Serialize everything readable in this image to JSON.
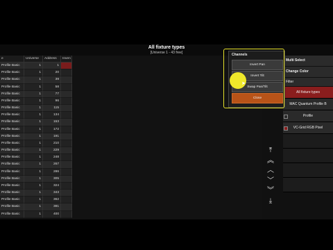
{
  "window": {
    "title": "All fixture types",
    "subtitle": "[Universe 1 - 43 free]"
  },
  "table": {
    "headers": [
      "e",
      "Universe",
      "Address",
      "Inven"
    ],
    "rows": [
      [
        "Profile Basic",
        "1",
        "1"
      ],
      [
        "Profile Basic",
        "1",
        "20"
      ],
      [
        "Profile Basic",
        "1",
        "39"
      ],
      [
        "Profile Basic",
        "1",
        "58"
      ],
      [
        "Profile Basic",
        "1",
        "77"
      ],
      [
        "Profile Basic",
        "1",
        "96"
      ],
      [
        "Profile Basic",
        "1",
        "115"
      ],
      [
        "Profile Basic",
        "1",
        "134"
      ],
      [
        "Profile Basic",
        "1",
        "153"
      ],
      [
        "Profile Basic",
        "1",
        "172"
      ],
      [
        "Profile Basic",
        "1",
        "191"
      ],
      [
        "Profile Basic",
        "1",
        "210"
      ],
      [
        "Profile Basic",
        "1",
        "229"
      ],
      [
        "Profile Basic",
        "1",
        "248"
      ],
      [
        "Profile Basic",
        "1",
        "267"
      ],
      [
        "Profile Basic",
        "1",
        "286"
      ],
      [
        "Profile Basic",
        "1",
        "305"
      ],
      [
        "Profile Basic",
        "1",
        "324"
      ],
      [
        "Profile Basic",
        "1",
        "343"
      ],
      [
        "Profile Basic",
        "1",
        "362"
      ],
      [
        "Profile Basic",
        "1",
        "381"
      ],
      [
        "Profile Basic",
        "1",
        "400"
      ]
    ]
  },
  "right_panel": {
    "multi_select": "Multi Select",
    "change_color": "Change Color",
    "filter": "Filter",
    "items": [
      "All fixture types",
      "MAC Quantum Profile B",
      "Profile",
      "VC-Grid RGB Pixel"
    ]
  },
  "popup": {
    "title": "Channels",
    "buttons": [
      "Invert Pan",
      "Invert Tilt",
      "Swap Pan/Tilt"
    ],
    "close": "Close"
  },
  "scroll_arrows": [
    "⤒",
    "︽",
    "︿",
    "﹀",
    "︾",
    "⤓"
  ],
  "colors": {
    "selected": "#8a1d1d",
    "close": "#b85318",
    "highlight": "#e6e12a"
  }
}
